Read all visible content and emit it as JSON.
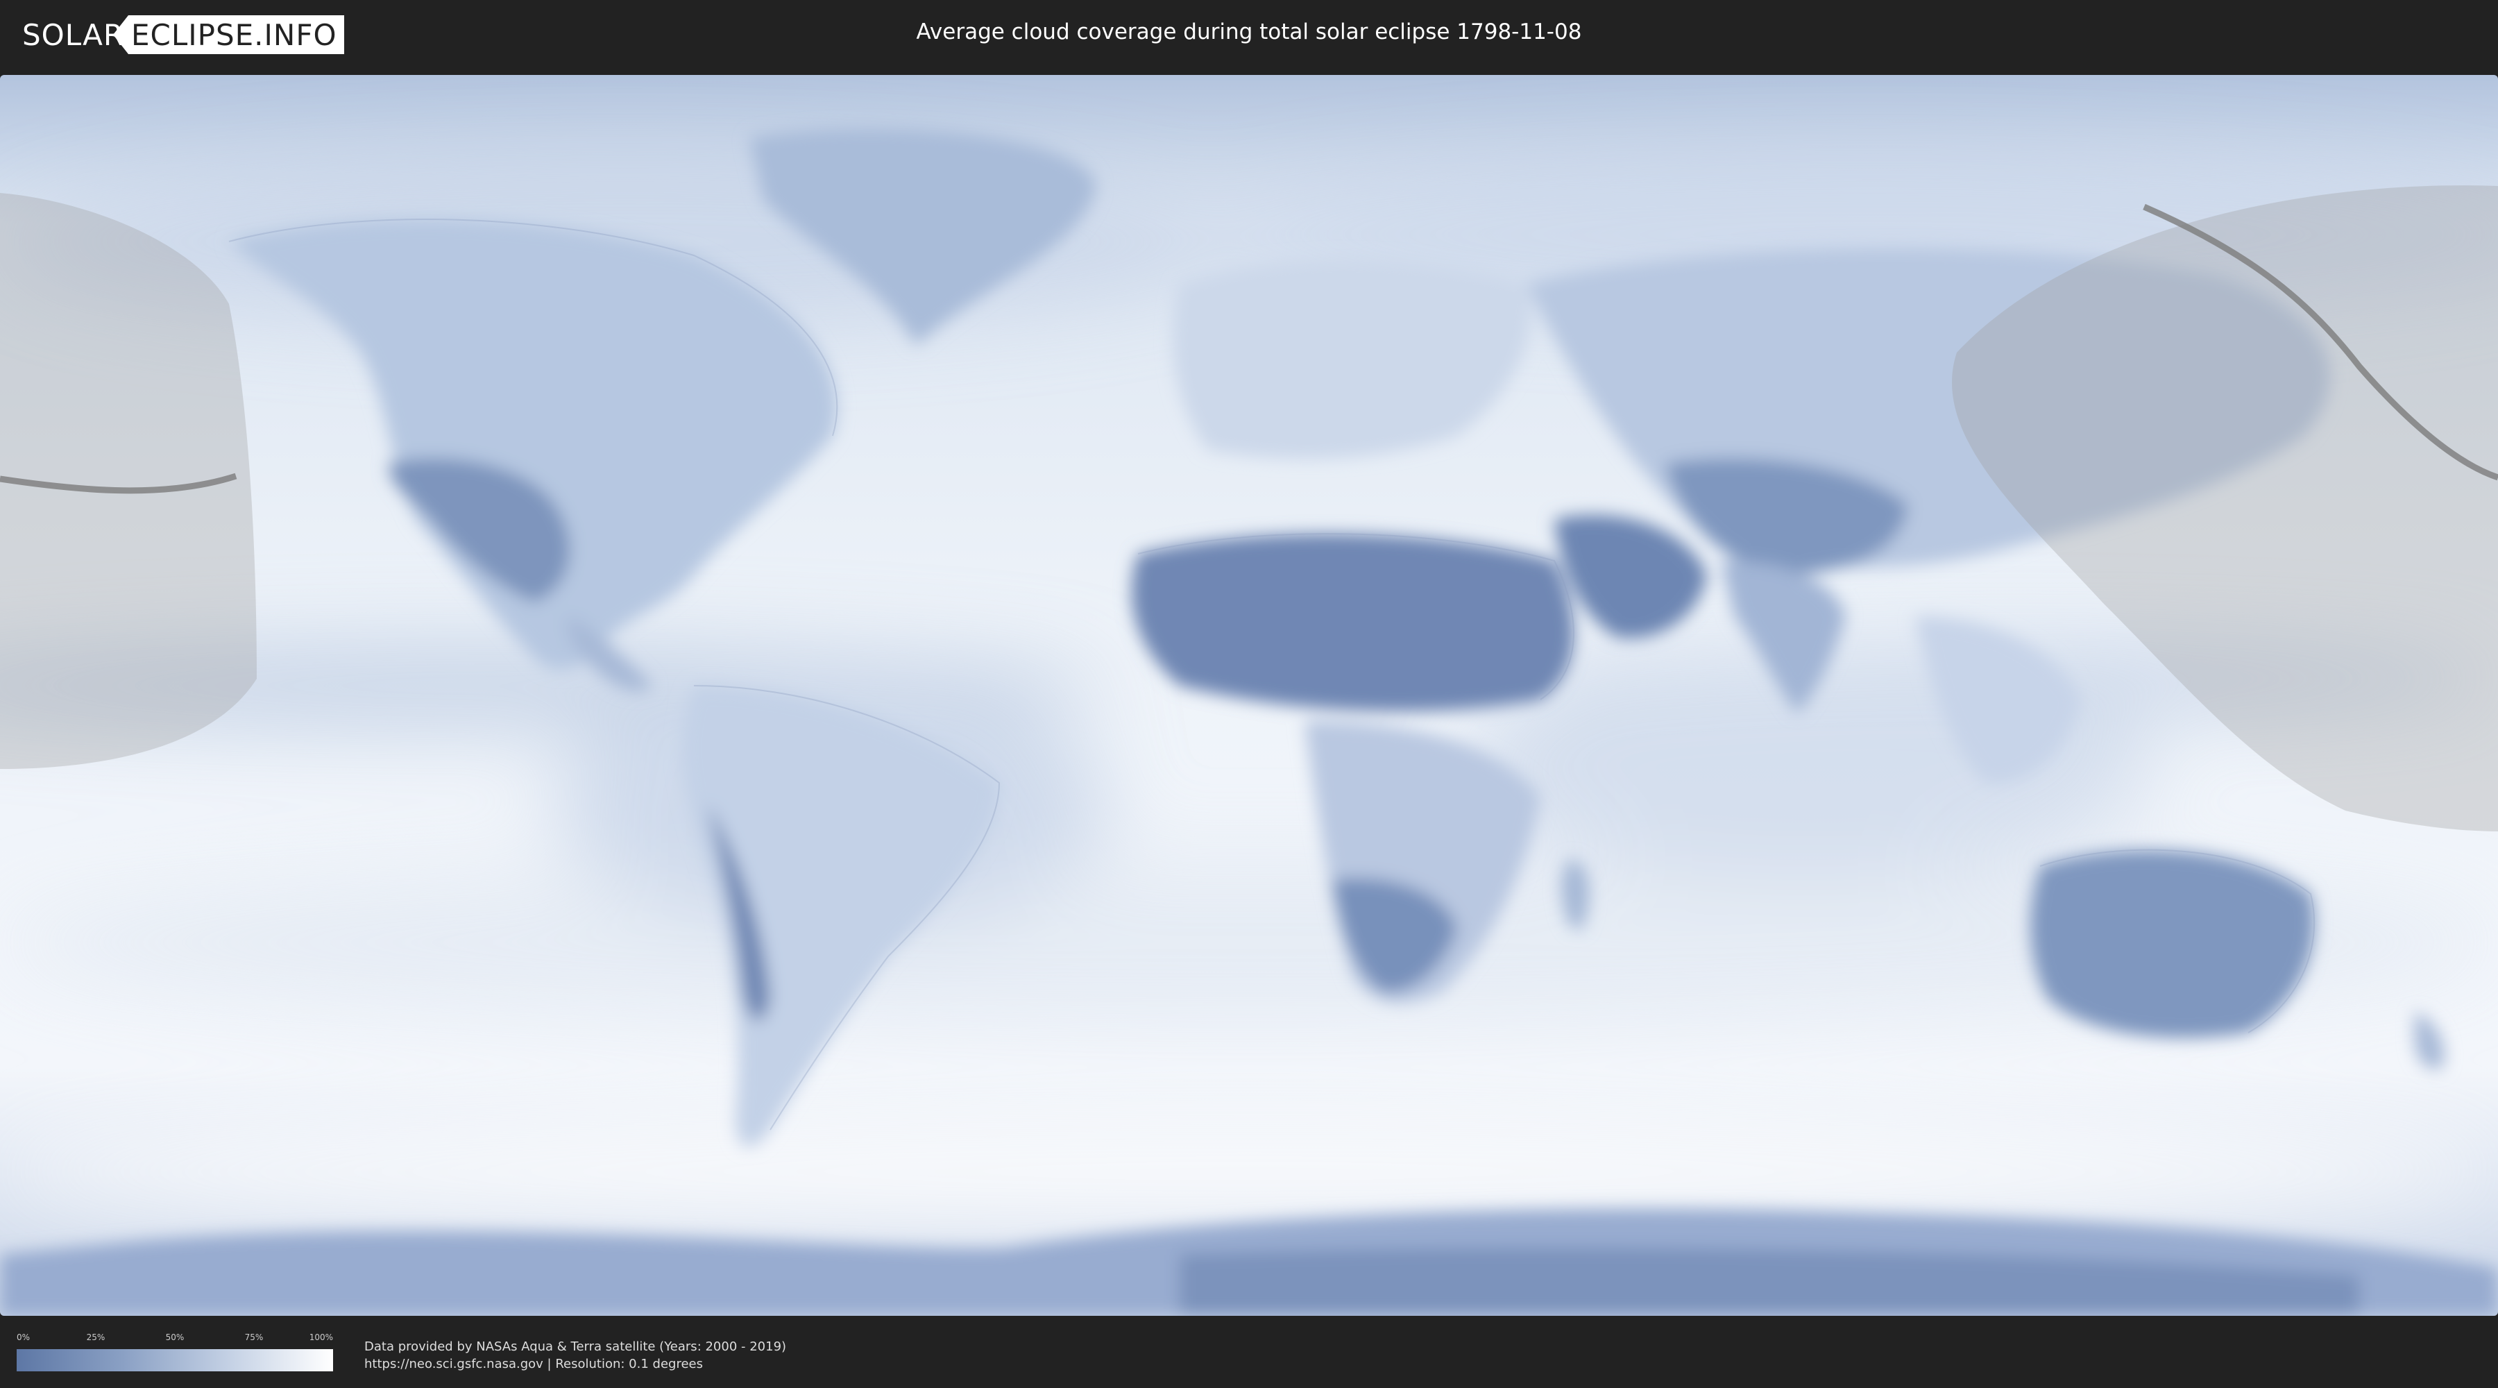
{
  "header": {
    "logo_left": "SOLAR",
    "logo_right": "ECLIPSE.INFO",
    "title": "Average cloud coverage during total solar eclipse 1798-11-08"
  },
  "map": {
    "projection": "equirectangular",
    "colors": {
      "ocean_clear": "#ffffff",
      "cloud_low": "#5d77a5",
      "cloud_mid": "#a9bad6",
      "shadow_overlay": "#9a9a9a",
      "path_line": "#777777"
    },
    "night_shadow_regions": [
      "west-pacific-left-edge",
      "east-asia-pacific-right-edge"
    ],
    "eclipse_path": "central line across north-east Asia and north Pacific"
  },
  "legend": {
    "ticks": [
      "0%",
      "25%",
      "50%",
      "75%",
      "100%"
    ],
    "gradient": [
      "#5d77a5",
      "#8aa0c4",
      "#c3d0e4",
      "#ffffff"
    ]
  },
  "credits": {
    "line1": "Data provided by NASAs Aqua & Terra satellite (Years: 2000 - 2019)",
    "line2": "https://neo.sci.gsfc.nasa.gov | Resolution: 0.1 degrees"
  }
}
